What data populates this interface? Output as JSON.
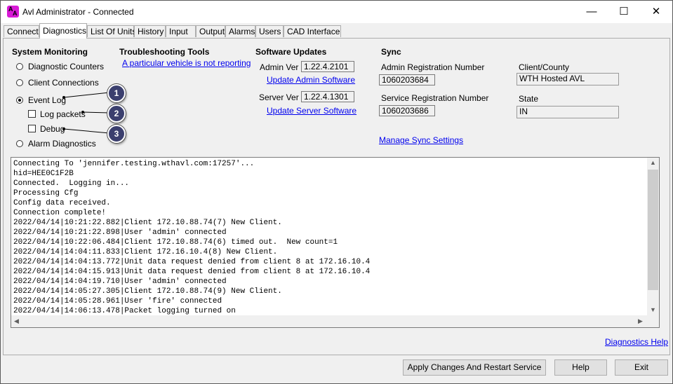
{
  "window": {
    "title": "Avl Administrator - Connected",
    "icon": "avl-app-icon",
    "controls": {
      "minimize": "—",
      "maximize": "☐",
      "close": "✕"
    }
  },
  "tabs": [
    "Connect",
    "Diagnostics",
    "List Of Units",
    "History",
    "Input",
    "Output",
    "Alarms",
    "Users",
    "CAD Interface"
  ],
  "active_tab": "Diagnostics",
  "system_monitoring": {
    "heading": "System Monitoring",
    "options": [
      "Diagnostic Counters",
      "Client Connections",
      "Event Log",
      "Alarm Diagnostics"
    ],
    "selected": "Event Log",
    "sub_options": [
      "Log packets",
      "Debug"
    ]
  },
  "callouts": [
    "1",
    "2",
    "3"
  ],
  "troubleshooting": {
    "heading": "Troubleshooting Tools",
    "link": "A particular vehicle is not reporting"
  },
  "software_updates": {
    "heading": "Software Updates",
    "admin_ver_label": "Admin Ver",
    "admin_ver": "1.22.4.2101",
    "update_admin": "Update Admin Software",
    "server_ver_label": "Server Ver",
    "server_ver": "1.22.4.1301",
    "update_server": "Update Server Software"
  },
  "sync": {
    "heading": "Sync",
    "admin_reg_label": "Admin Registration Number",
    "admin_reg": "1060203684",
    "service_reg_label": "Service Registration Number",
    "service_reg": "1060203686",
    "manage_link": "Manage Sync Settings",
    "client_county_label": "Client/County",
    "client_county": "WTH Hosted AVL",
    "state_label": "State",
    "state": "IN"
  },
  "log": {
    "lines": [
      "Connecting To 'jennifer.testing.wthavl.com:17257'...",
      "hid=HEE0C1F2B",
      "Connected.  Logging in...",
      "Processing Cfg",
      "Config data received.",
      "Connection complete!",
      "2022/04/14|10:21:22.882|Client 172.10.88.74(7) New Client.",
      "2022/04/14|10:21:22.898|User 'admin' connected",
      "2022/04/14|10:22:06.484|Client 172.10.88.74(6) timed out.  New count=1",
      "2022/04/14|14:04:11.833|Client 172.16.10.4(8) New Client.",
      "2022/04/14|14:04:13.772|Unit data request denied from client 8 at 172.16.10.4",
      "2022/04/14|14:04:15.913|Unit data request denied from client 8 at 172.16.10.4",
      "2022/04/14|14:04:19.710|User 'admin' connected",
      "2022/04/14|14:05:27.305|Client 172.10.88.74(9) New Client.",
      "2022/04/14|14:05:28.961|User 'fire' connected",
      "2022/04/14|14:06:13.478|Packet logging turned on"
    ]
  },
  "footer": {
    "help_link": "Diagnostics Help",
    "apply_button": "Apply Changes And Restart Service",
    "help_button": "Help",
    "exit_button": "Exit"
  },
  "colors": {
    "link": "#0000ee",
    "callout": "#3b3f6e",
    "icon": "#d81ad6"
  }
}
